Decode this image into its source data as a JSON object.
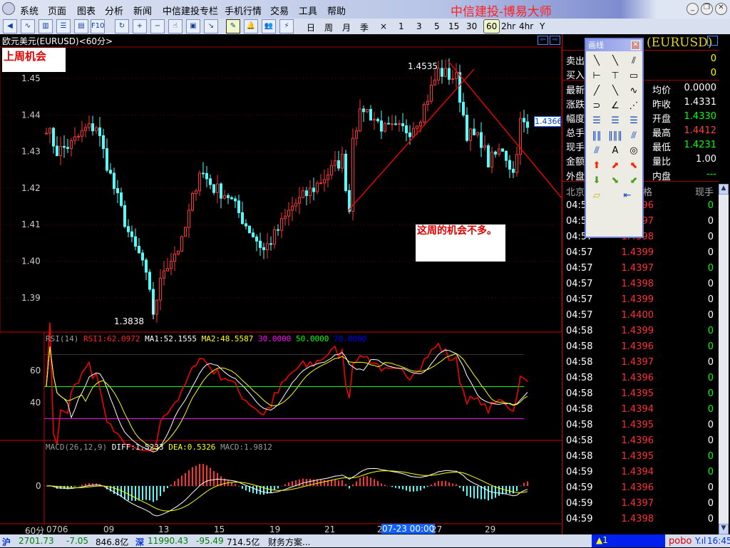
{
  "menu": {
    "items": [
      "系统",
      "页面",
      "图表",
      "分析",
      "新闻",
      "中信建投专栏",
      "手机行情",
      "交易",
      "工具",
      "帮助"
    ],
    "brand": "中信建投-博易大师"
  },
  "toolbar": {
    "icons": [
      "back-icon",
      "line-chart-icon",
      "kline-icon",
      "table-icon",
      "quote-icon",
      "f10-icon",
      "refresh-icon",
      "zoom-in-icon",
      "zoom-out-icon",
      "cursor-icon",
      "window-icon",
      "export-icon",
      "draw-icon",
      "alarm-icon",
      "users-icon",
      "lightning-icon"
    ],
    "f10": "F10",
    "periods": [
      "日",
      "周",
      "月",
      "季",
      "×",
      "1",
      "3",
      "5",
      "15",
      "30",
      "60",
      "2hr",
      "4hr",
      "Y"
    ],
    "selected_period": "60"
  },
  "chart": {
    "title": "欧元美元(EURUSD)<60分>",
    "note1": "上周机会",
    "note2": "这周的机会不多。",
    "high_label": "1.4535",
    "low_label": "1.3838",
    "last_tag": "1.4366",
    "y_ticks": [
      "1.45",
      "1.44",
      "1.43",
      "1.42",
      "1.41",
      "1.40",
      "1.39"
    ],
    "x_ticks": [
      "0706",
      "09",
      "13",
      "15",
      "19",
      "21",
      "2",
      "27",
      "29"
    ],
    "period_label": "60分",
    "cursor_time": "07-23 00:00"
  },
  "rsi": {
    "name": "RSI(14)",
    "rsi1": "RSI1:62.0972",
    "ma1": "MA1:52.1555",
    "ma2": "MA2:48.5587",
    "l30": "30.0000",
    "l50": "50.0000",
    "l70": "70.0000",
    "ticks": [
      "60",
      "40"
    ]
  },
  "macd": {
    "name": "MACD(26,12,9)",
    "diff": "DIFF:1.5233",
    "dea": "DEA:0.5326",
    "macd": "MACD:1.9812",
    "ticks": [
      "0"
    ]
  },
  "chart_data": {
    "type": "candlestick",
    "title": "欧元美元(EURUSD)<60分>",
    "ylim": [
      1.38,
      1.455
    ],
    "waypoints": [
      [
        0,
        1.437
      ],
      [
        3,
        1.43
      ],
      [
        7,
        1.432
      ],
      [
        11,
        1.436
      ],
      [
        14,
        1.437
      ],
      [
        16,
        1.43
      ],
      [
        19,
        1.42
      ],
      [
        24,
        1.405
      ],
      [
        27,
        1.4
      ],
      [
        30,
        1.386
      ],
      [
        33,
        1.398
      ],
      [
        38,
        1.405
      ],
      [
        43,
        1.425
      ],
      [
        47,
        1.42
      ],
      [
        51,
        1.418
      ],
      [
        56,
        1.41
      ],
      [
        61,
        1.403
      ],
      [
        64,
        1.407
      ],
      [
        69,
        1.415
      ],
      [
        75,
        1.42
      ],
      [
        83,
        1.428
      ],
      [
        85,
        1.414
      ],
      [
        86,
        1.435
      ],
      [
        89,
        1.442
      ],
      [
        95,
        1.436
      ],
      [
        102,
        1.436
      ],
      [
        105,
        1.44
      ],
      [
        110,
        1.452
      ],
      [
        115,
        1.45
      ],
      [
        118,
        1.435
      ],
      [
        122,
        1.433
      ],
      [
        124,
        1.427
      ],
      [
        128,
        1.431
      ],
      [
        131,
        1.424
      ],
      [
        133,
        1.438
      ],
      [
        135,
        1.4366
      ]
    ]
  },
  "quote": {
    "symbol": "(EURUSD)",
    "left_labels": [
      "卖出",
      "买入",
      "最新",
      "涨跌",
      "幅度",
      "总手",
      "现手",
      "金额",
      "外盘"
    ],
    "sell": "0",
    "buy": "0",
    "right": [
      {
        "label": "均价",
        "value": "0.0000",
        "color": "#ffffff"
      },
      {
        "label": "昨收",
        "value": "1.4331",
        "color": "#ffffff"
      },
      {
        "label": "开盘",
        "value": "1.4330",
        "color": "#00ff00"
      },
      {
        "label": "最高",
        "value": "1.4412",
        "color": "#ff4040"
      },
      {
        "label": "最低",
        "value": "1.4231",
        "color": "#00ff00"
      },
      {
        "label": "量比",
        "value": "1.00",
        "color": "#ffffff"
      },
      {
        "label": "内盘",
        "value": "---",
        "color": "#00ff00"
      }
    ],
    "cols": [
      "北京",
      "格",
      "现手"
    ]
  },
  "ticks": [
    [
      "04:57",
      "1.4396",
      "0",
      1
    ],
    [
      "04:57",
      "1.4397",
      "0",
      0
    ],
    [
      "04:57",
      "1.4398",
      "0",
      0
    ],
    [
      "04:57",
      "1.4399",
      "0",
      0
    ],
    [
      "04:57",
      "1.4397",
      "0",
      1
    ],
    [
      "04:57",
      "1.4398",
      "0",
      0
    ],
    [
      "04:57",
      "1.4399",
      "0",
      0
    ],
    [
      "04:57",
      "1.4400",
      "0",
      0
    ],
    [
      "04:58",
      "1.4399",
      "0",
      1
    ],
    [
      "04:58",
      "1.4396",
      "0",
      1
    ],
    [
      "04:58",
      "1.4397",
      "0",
      0
    ],
    [
      "04:58",
      "1.4396",
      "0",
      1
    ],
    [
      "04:58",
      "1.4395",
      "0",
      1
    ],
    [
      "04:58",
      "1.4394",
      "0",
      1
    ],
    [
      "04:58",
      "1.4395",
      "0",
      0
    ],
    [
      "04:58",
      "1.4396",
      "0",
      0
    ],
    [
      "04:58",
      "1.4395",
      "0",
      1
    ],
    [
      "04:59",
      "1.4394",
      "0",
      1
    ],
    [
      "04:59",
      "1.4396",
      "0",
      0
    ],
    [
      "04:59",
      "1.4397",
      "0",
      0
    ],
    [
      "04:59",
      "1.4398",
      "0",
      0
    ]
  ],
  "toolbox": {
    "title": "画线",
    "tools": [
      "line-icon",
      "segment-icon",
      "parallel-icon",
      "hline-icon",
      "vline-icon",
      "rect-icon",
      "ray-icon",
      "ray-down-icon",
      "wave-icon",
      "arc-icon",
      "angle-icon",
      "fan-icon",
      "gann-icon",
      "fib-icon",
      "fib2-icon",
      "cycle-icon",
      "cycle2-icon",
      "channel-icon",
      "speed-icon",
      "text-icon",
      "circle-icon",
      "up-arrow-icon",
      "up-right-arrow-icon",
      "up-left-arrow-icon",
      "down-arrow-icon",
      "down-right-arrow-icon",
      "down-left-arrow-icon",
      "eraser-icon",
      "delete-all-icon"
    ],
    "text_tool": "A"
  },
  "status": {
    "sh_label": "沪",
    "sh": "2701.73",
    "sh_chg": "-7.05",
    "sh_amt": "846.8亿",
    "sz_label": "深",
    "sz": "11990.43",
    "sz_chg": "-95.49",
    "sz_amt": "714.5亿",
    "news": "财务方案...",
    "alert": "▲1",
    "brand": "pobo",
    "time": "16:45"
  },
  "colors": {
    "up": "#ff3232",
    "down": "#54fcfc",
    "ma1": "#ffffff",
    "ma2": "#ffff00"
  }
}
